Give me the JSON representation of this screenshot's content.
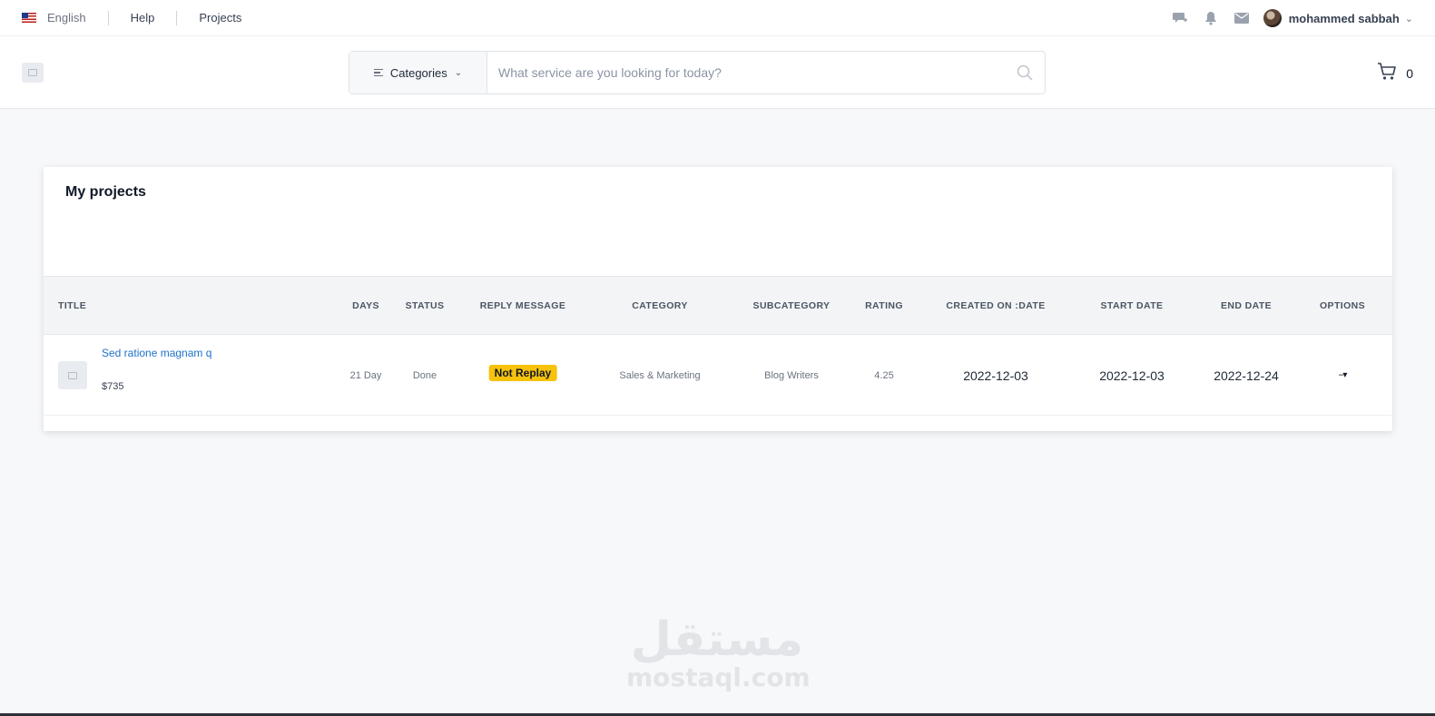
{
  "topbar": {
    "language": "English",
    "help": "Help",
    "projects": "Projects",
    "username": "mohammed sabbah",
    "icons": [
      "flag-us-icon",
      "chat-plus-icon",
      "bell-icon",
      "mail-icon",
      "avatar",
      "chevron-down-icon"
    ]
  },
  "header": {
    "categories_label": "Categories",
    "search_placeholder": "What service are you looking for today?",
    "cart_count": "0"
  },
  "projects_card": {
    "title": "My projects",
    "columns": [
      "TITLE",
      "DAYS",
      "STATUS",
      "REPLY MESSAGE",
      "CATEGORY",
      "SUBCATEGORY",
      "RATING",
      "CREATED ON :DATE",
      "START DATE",
      "END DATE",
      "OPTIONS"
    ],
    "rows": [
      {
        "title": "Sed ratione magnam q",
        "price": "$735",
        "days": "21 Day",
        "status": "Done",
        "reply_message": "Not Replay",
        "category": "Sales & Marketing",
        "subcategory": "Blog Writers",
        "rating": "4.25",
        "created_on": "2022-12-03",
        "start_date": "2022-12-03",
        "end_date": "2022-12-24",
        "options": "--▾"
      }
    ]
  },
  "watermark": {
    "arabic": "مستقل",
    "latin": "mostaql.com"
  },
  "colors": {
    "link": "#1d72c9",
    "badge": "#f6c20b",
    "page_bg": "#f7f8fa"
  }
}
